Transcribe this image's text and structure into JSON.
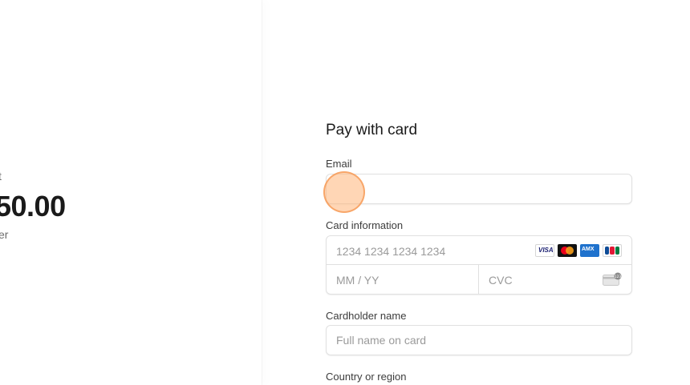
{
  "summary": {
    "amount_label": "t",
    "amount": "50.00",
    "amount_sub": "er"
  },
  "form": {
    "title": "Pay with card",
    "email": {
      "label": "Email",
      "value": "",
      "placeholder": ""
    },
    "card_information": {
      "label": "Card information",
      "number_placeholder": "1234 1234 1234 1234",
      "expiry_placeholder": "MM / YY",
      "cvc_placeholder": "CVC",
      "brands": [
        "visa",
        "mastercard",
        "amex",
        "jcb"
      ],
      "visa_text": "VISA"
    },
    "cardholder": {
      "label": "Cardholder name",
      "placeholder": "Full name on card"
    },
    "country": {
      "label": "Country or region"
    }
  },
  "colors": {
    "border": "#e0e0e0",
    "placeholder": "#9a9a9a",
    "cursor_highlight": "#f59650"
  }
}
